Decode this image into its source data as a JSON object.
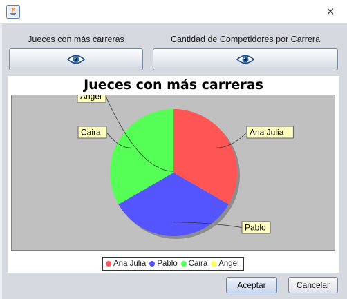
{
  "window": {
    "close_symbol": "✕"
  },
  "header": {
    "left_label": "Jueces con más carreras",
    "right_label": "Cantidad de Competidores por Carrera",
    "view_icon": "eye-icon"
  },
  "chart_data": {
    "type": "pie",
    "title": "Jueces con más carreras",
    "slices": [
      {
        "label": "Ana Julia",
        "value": 1,
        "color": "#ff5555"
      },
      {
        "label": "Pablo",
        "value": 1,
        "color": "#5555ff"
      },
      {
        "label": "Caira",
        "value": 1,
        "color": "#55ff55"
      },
      {
        "label": "Angel",
        "value": 0,
        "color": "#ffff55"
      }
    ],
    "legend_position": "bottom",
    "plot_background": "#c0c0c0"
  },
  "buttons": {
    "ok": "Aceptar",
    "cancel": "Cancelar"
  }
}
